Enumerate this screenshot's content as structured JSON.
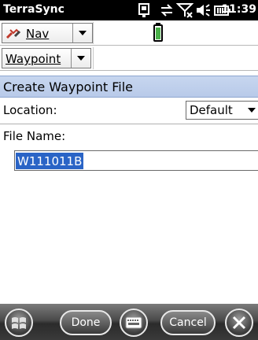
{
  "status_bar": {
    "app_title": "TerraSync",
    "time": "11:39",
    "icons": [
      "gps-device-icon",
      "sync-arrows-icon",
      "signal-off-icon",
      "volume-icon",
      "battery-icon"
    ]
  },
  "toolbar": {
    "section_dropdown": {
      "label": "Nav",
      "icon": "satellite-icon"
    },
    "status_icon": "battery-level-icon"
  },
  "sub_toolbar": {
    "section_dropdown": {
      "label": "Waypoint"
    }
  },
  "form": {
    "title": "Create Waypoint File",
    "location_label": "Location:",
    "location_value": "Default",
    "file_name_label": "File Name:",
    "file_name_value": "W111011B"
  },
  "taskbar": {
    "start_icon": "windows-start-icon",
    "done_label": "Done",
    "keyboard_icon": "keyboard-icon",
    "cancel_label": "Cancel",
    "close_icon": "close-icon"
  },
  "colors": {
    "header_bg": "#c7d6ef",
    "selection": "#2a64c6",
    "taskbar": "#3a3a3a"
  }
}
